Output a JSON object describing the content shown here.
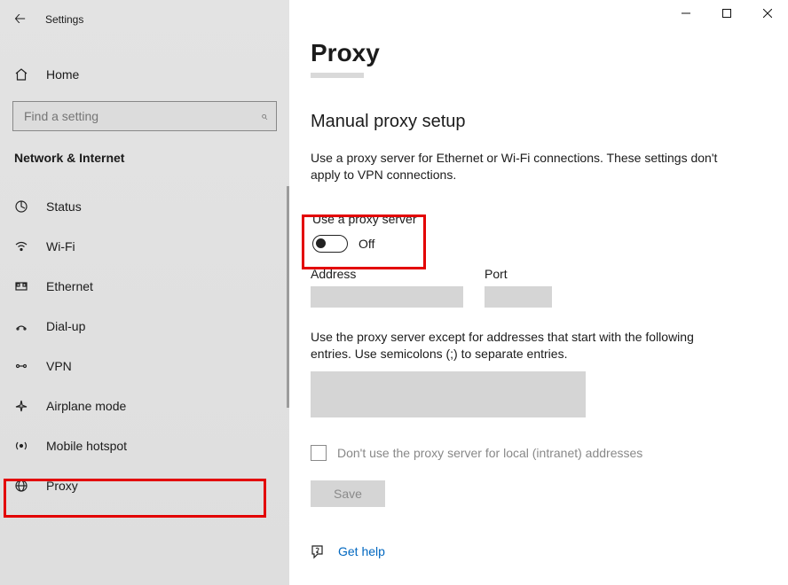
{
  "app": {
    "title": "Settings"
  },
  "sidebar": {
    "home_label": "Home",
    "search_placeholder": "Find a setting",
    "section_title": "Network & Internet",
    "items": [
      {
        "label": "Status"
      },
      {
        "label": "Wi-Fi"
      },
      {
        "label": "Ethernet"
      },
      {
        "label": "Dial-up"
      },
      {
        "label": "VPN"
      },
      {
        "label": "Airplane mode"
      },
      {
        "label": "Mobile hotspot"
      },
      {
        "label": "Proxy"
      }
    ]
  },
  "page": {
    "title": "Proxy",
    "section_heading": "Manual proxy setup",
    "description": "Use a proxy server for Ethernet or Wi-Fi connections. These settings don't apply to VPN connections.",
    "toggle_label": "Use a proxy server",
    "toggle_state": "Off",
    "address_label": "Address",
    "port_label": "Port",
    "exceptions_label": "Use the proxy server except for addresses that start with the following entries. Use semicolons (;) to separate entries.",
    "local_bypass_label": "Don't use the proxy server for local (intranet) addresses",
    "save_label": "Save",
    "help_label": "Get help"
  }
}
